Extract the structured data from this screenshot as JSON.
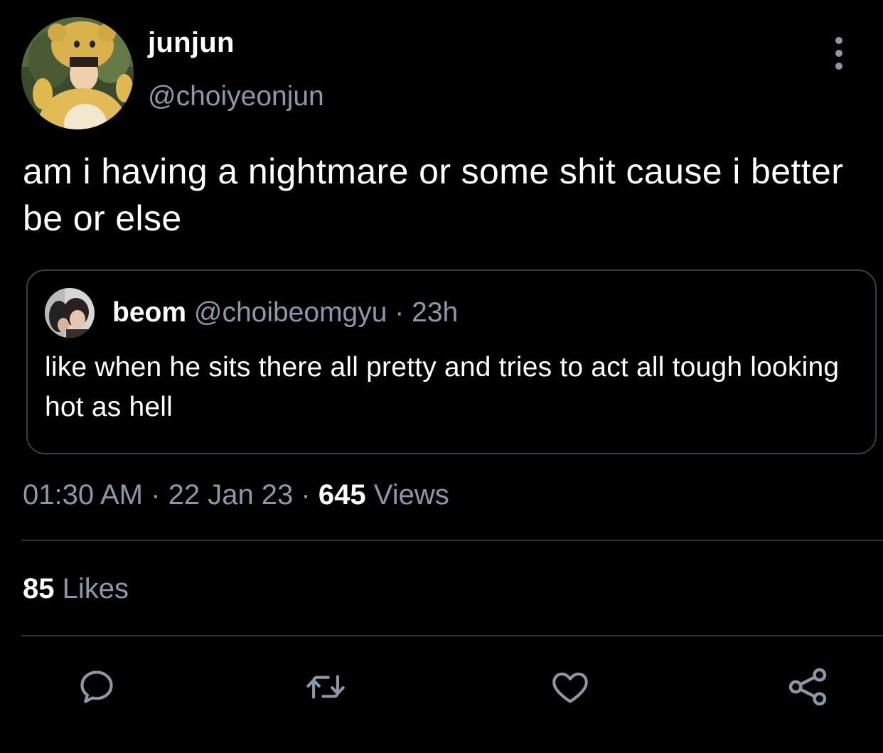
{
  "tweet": {
    "author": {
      "display_name": "junjun",
      "handle": "@choiyeonjun"
    },
    "text": "am i having a nightmare or some shit cause i better be or else",
    "quoted": {
      "display_name": "beom",
      "handle": "@choibeomgyu",
      "separator": "·",
      "time": "23h",
      "text": "like when he sits there all pretty and tries to act all tough looking hot as hell"
    },
    "meta": {
      "time": "01:30 AM",
      "separator": "·",
      "date": "22 Jan 23",
      "views_count": "645",
      "views_label": "Views"
    },
    "stats": {
      "likes_count": "85",
      "likes_label": "Likes"
    }
  },
  "icons": {
    "more": "more-vertical-icon",
    "reply": "reply-icon",
    "retweet": "retweet-icon",
    "like": "heart-icon",
    "share": "share-icon"
  },
  "colors": {
    "background": "#000000",
    "primary_text": "#ffffff",
    "secondary_text": "#8b98a5",
    "divider": "#2f3336"
  }
}
